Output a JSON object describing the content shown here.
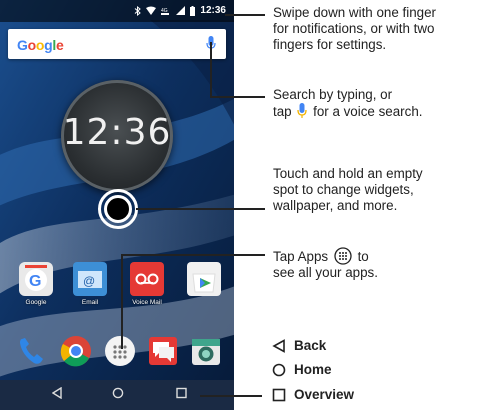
{
  "status_bar": {
    "time": "12:36",
    "icons": [
      "bluetooth-icon",
      "wifi-icon",
      "lte-icon",
      "signal-icon",
      "battery-icon"
    ]
  },
  "search_bar": {
    "logo": "Google"
  },
  "clock_widget": {
    "time": "12:36"
  },
  "apps_row": [
    {
      "label": "Google",
      "icon": "google-icon"
    },
    {
      "label": "Email",
      "icon": "email-icon"
    },
    {
      "label": "Voice Mail",
      "icon": "voicemail-icon"
    },
    {
      "label": "",
      "icon": "play-store-icon"
    }
  ],
  "dock": [
    "phone-icon",
    "chrome-icon",
    "apps-icon",
    "messages-icon",
    "camera-icon"
  ],
  "callouts": {
    "swipe": [
      "Swipe down with one finger",
      "for notifications, or with two",
      "fingers for settings."
    ],
    "search": [
      "Search by typing, or",
      "for a voice search."
    ],
    "search_tap": "tap",
    "touch": [
      "Touch and hold an empty",
      "spot to change widgets,",
      "wallpaper, and more."
    ],
    "apps_line1_prefix": "Tap Apps",
    "apps_line1_suffix": "to",
    "apps_line2": "see all your apps."
  },
  "legend": {
    "back": "Back",
    "home": "Home",
    "overview": "Overview"
  },
  "colors": {
    "google_blue": "#4285F4",
    "voicemail_red": "#E53935",
    "wallpaper": "#0a2a55"
  }
}
